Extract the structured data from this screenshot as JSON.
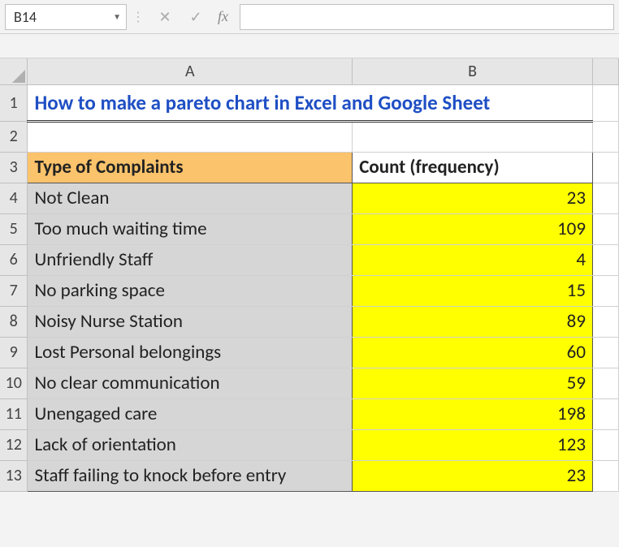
{
  "name_box": "B14",
  "fx_label": "fx",
  "formula_value": "",
  "columns": [
    "A",
    "B"
  ],
  "title": "How to make a pareto chart in Excel and Google Sheet",
  "headers": {
    "col_a": "Type of Complaints",
    "col_b": "Count (frequency)"
  },
  "rows": [
    {
      "num": "1"
    },
    {
      "num": "2"
    },
    {
      "num": "3"
    },
    {
      "num": "4",
      "a": "Not Clean",
      "b": "23"
    },
    {
      "num": "5",
      "a": "Too much waiting time",
      "b": "109"
    },
    {
      "num": "6",
      "a": "Unfriendly Staff",
      "b": "4"
    },
    {
      "num": "7",
      "a": "No parking space",
      "b": "15"
    },
    {
      "num": "8",
      "a": "Noisy Nurse Station",
      "b": "89"
    },
    {
      "num": "9",
      "a": "Lost Personal belongings",
      "b": "60"
    },
    {
      "num": "10",
      "a": "No clear communication",
      "b": "59"
    },
    {
      "num": "11",
      "a": "Unengaged care",
      "b": "198"
    },
    {
      "num": "12",
      "a": "Lack of orientation",
      "b": "123"
    },
    {
      "num": "13",
      "a": "Staff failing to knock before entry",
      "b": "23"
    }
  ],
  "chart_data": {
    "type": "table",
    "title": "How to make a pareto chart in Excel and Google Sheet",
    "columns": [
      "Type of Complaints",
      "Count (frequency)"
    ],
    "data": [
      {
        "Type of Complaints": "Not Clean",
        "Count (frequency)": 23
      },
      {
        "Type of Complaints": "Too much waiting time",
        "Count (frequency)": 109
      },
      {
        "Type of Complaints": "Unfriendly Staff",
        "Count (frequency)": 4
      },
      {
        "Type of Complaints": "No parking space",
        "Count (frequency)": 15
      },
      {
        "Type of Complaints": "Noisy Nurse Station",
        "Count (frequency)": 89
      },
      {
        "Type of Complaints": "Lost Personal belongings",
        "Count (frequency)": 60
      },
      {
        "Type of Complaints": "No clear communication",
        "Count (frequency)": 59
      },
      {
        "Type of Complaints": "Unengaged care",
        "Count (frequency)": 198
      },
      {
        "Type of Complaints": "Lack of orientation",
        "Count (frequency)": 123
      },
      {
        "Type of Complaints": "Staff failing to knock before entry",
        "Count (frequency)": 23
      }
    ]
  }
}
